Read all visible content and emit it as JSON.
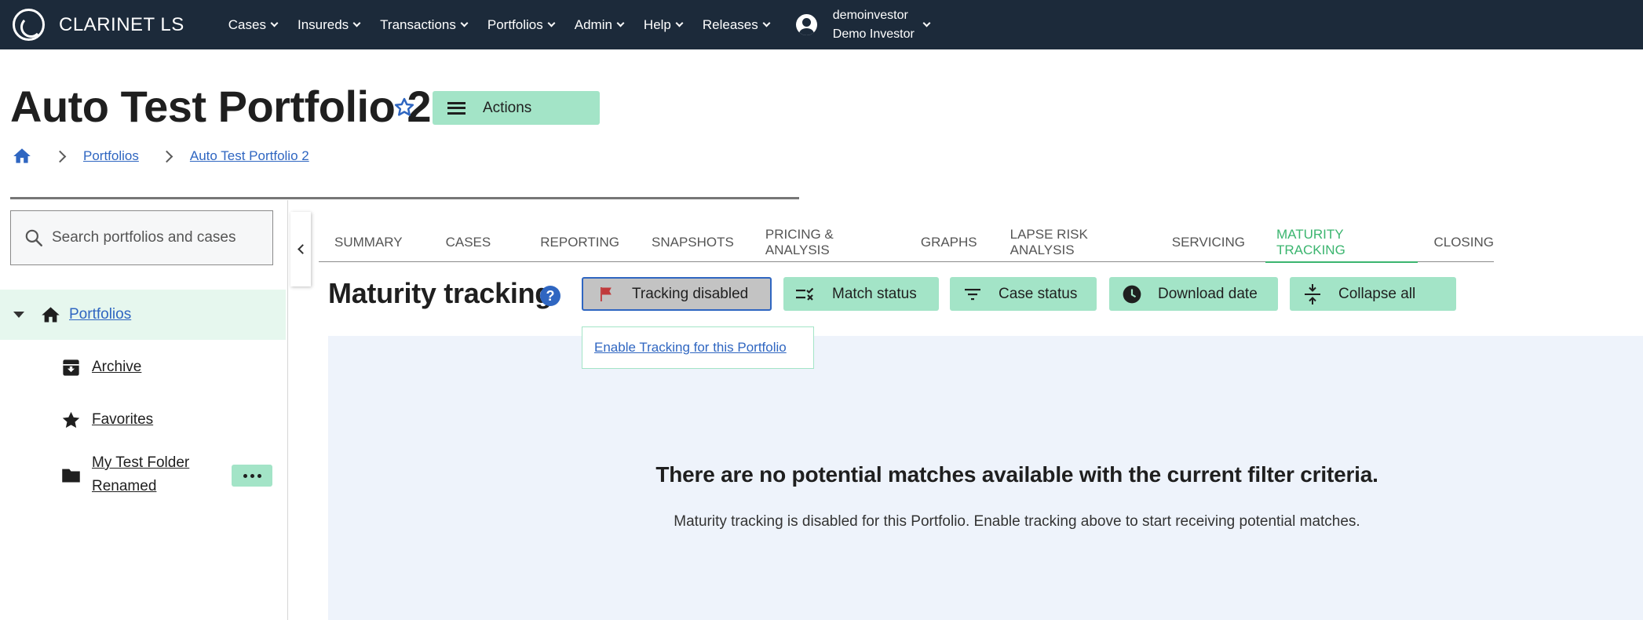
{
  "app": {
    "name": "CLARINET LS"
  },
  "nav": {
    "items": [
      "Cases",
      "Insureds",
      "Transactions",
      "Portfolios",
      "Admin",
      "Help",
      "Releases"
    ],
    "user": {
      "username": "demoinvestor",
      "display_name": "Demo Investor"
    }
  },
  "page": {
    "title": "Auto Test Portfolio 2",
    "actions_label": "Actions"
  },
  "breadcrumb": {
    "items": [
      "Portfolios",
      "Auto Test Portfolio 2"
    ]
  },
  "sidebar": {
    "search_placeholder": "Search portfolios and cases",
    "root_label": "Portfolios",
    "items": [
      {
        "label": "Archive",
        "icon": "archive-icon"
      },
      {
        "label": "Favorites",
        "icon": "star-icon"
      },
      {
        "label_line1": "My Test Folder",
        "label_line2": "Renamed",
        "icon": "folder-icon"
      }
    ]
  },
  "tabs": {
    "items": [
      "SUMMARY",
      "CASES",
      "REPORTING",
      "SNAPSHOTS",
      "PRICING & ANALYSIS",
      "GRAPHS",
      "LAPSE RISK ANALYSIS",
      "SERVICING",
      "MATURITY TRACKING",
      "CLOSING"
    ],
    "active": "MATURITY TRACKING"
  },
  "maturity": {
    "title": "Maturity tracking",
    "help_symbol": "?",
    "filters": {
      "tracking": "Tracking disabled",
      "match_status": "Match status",
      "case_status": "Case status",
      "download_date": "Download date",
      "collapse_all": "Collapse all"
    },
    "popover_link": "Enable Tracking for this Portfolio",
    "empty_title": "There are no potential matches available with the current filter criteria.",
    "empty_subtitle": "Maturity tracking is disabled for this Portfolio. Enable tracking above to start receiving potential matches."
  },
  "colors": {
    "nav_bg": "#1c2a3a",
    "accent_green": "#a3e4c7",
    "active_tab": "#3bb56f",
    "link_blue": "#2f66c1",
    "flag_red": "#c0393b",
    "empty_bg": "#eef3fb"
  }
}
